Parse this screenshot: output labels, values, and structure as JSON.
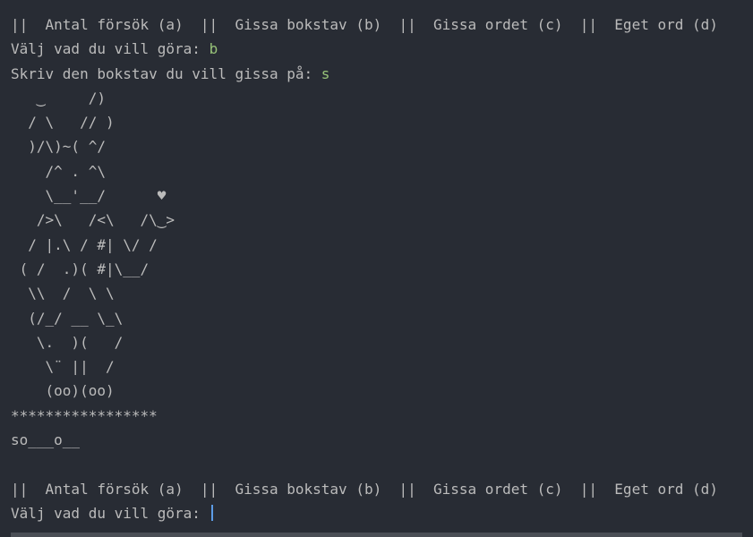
{
  "menu": {
    "line": "||  Antal försök (a)  ||  Gissa bokstav (b)  ||  Gissa ordet (c)  ||  Eget ord (d)"
  },
  "session": {
    "prompt_choice": "Välj vad du vill göra: ",
    "choice_value": "b",
    "prompt_letter": "Skriv den bokstav du vill gissa på: ",
    "letter_value": "s",
    "ascii_art": [
      "   ‿     /)",
      "  / \\   // )",
      "  )/\\)~( ^/",
      "    /^ . ^\\",
      "    \\__'__/      ♥",
      "   />\\   /<\\   /\\‿>",
      "  / |.\\ / #| \\/ /",
      " ( /  .)( #|\\__/",
      "  \\\\  /  \\ \\",
      "  (/_/ __ \\_\\",
      "   \\.  )(   /",
      "    \\¨ ||  /",
      "    (oo)(oo)"
    ],
    "stars": "*****************",
    "word_progress": "so___o__"
  },
  "next_prompt": {
    "menu_line": "||  Antal försök (a)  ||  Gissa bokstav (b)  ||  Gissa ordet (c)  ||  Eget ord (d)",
    "prompt_choice": "Välj vad du vill göra: "
  }
}
